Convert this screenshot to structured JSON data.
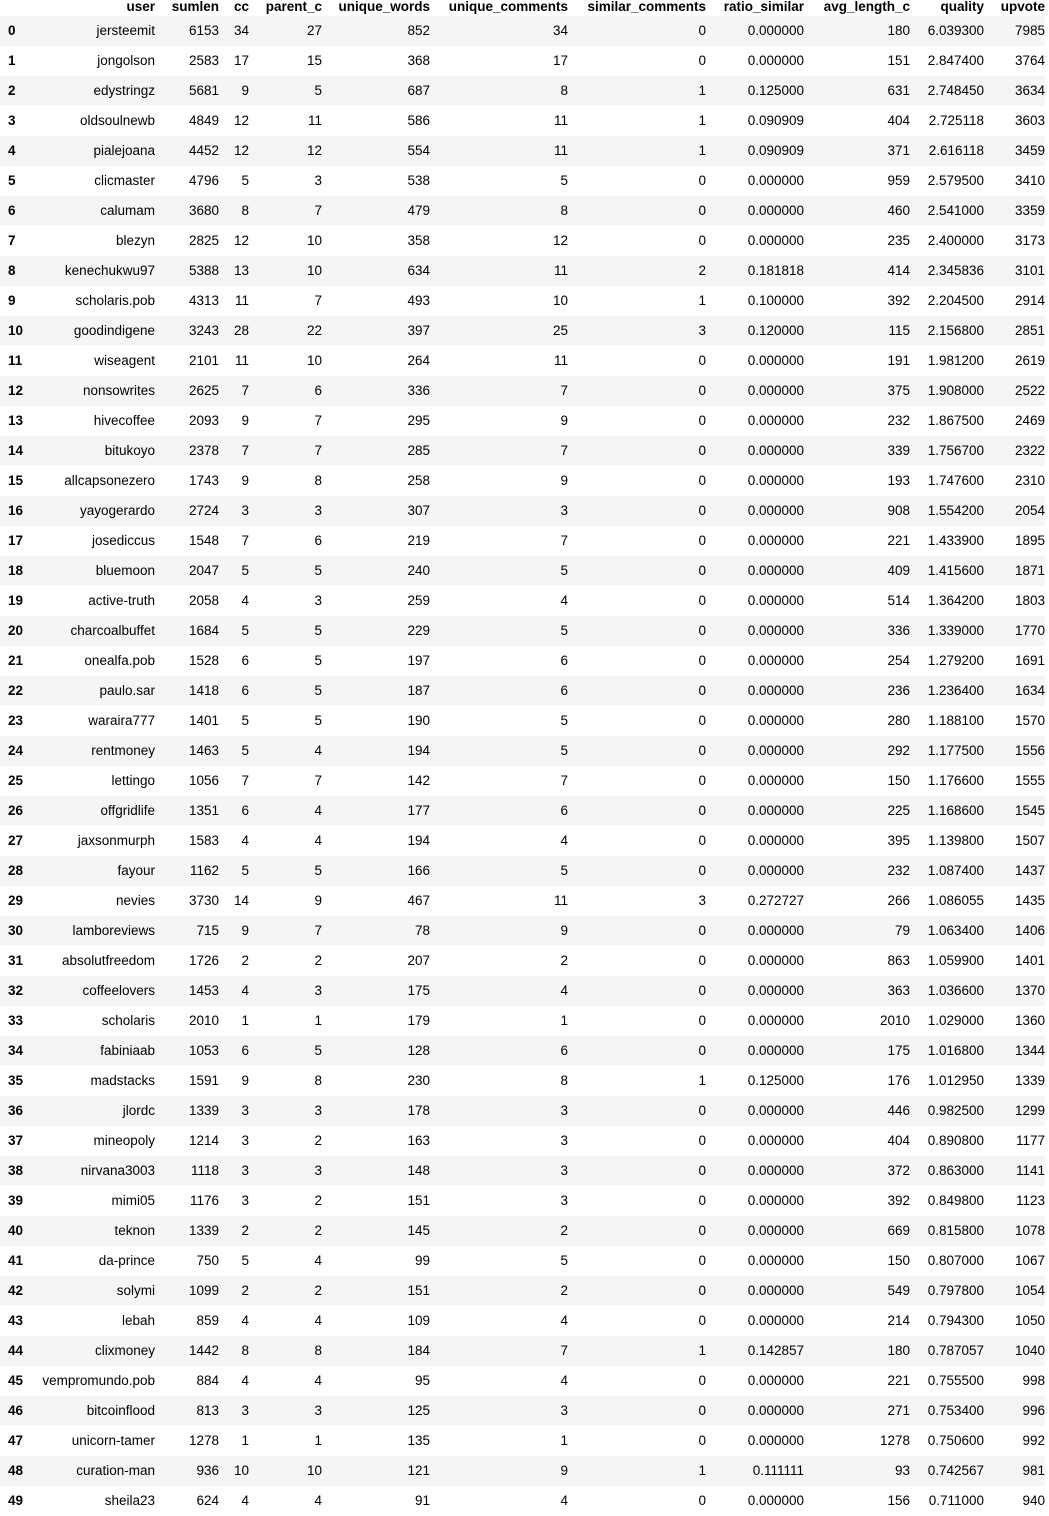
{
  "table": {
    "columns": [
      "user",
      "sumlen",
      "cc",
      "parent_c",
      "unique_words",
      "unique_comments",
      "similar_comments",
      "ratio_similar",
      "avg_length_c",
      "quality",
      "upvote"
    ],
    "rows": [
      [
        "0",
        "jersteemit",
        "6153",
        "34",
        "27",
        "852",
        "34",
        "0",
        "0.000000",
        "180",
        "6.039300",
        "7985"
      ],
      [
        "1",
        "jongolson",
        "2583",
        "17",
        "15",
        "368",
        "17",
        "0",
        "0.000000",
        "151",
        "2.847400",
        "3764"
      ],
      [
        "2",
        "edystringz",
        "5681",
        "9",
        "5",
        "687",
        "8",
        "1",
        "0.125000",
        "631",
        "2.748450",
        "3634"
      ],
      [
        "3",
        "oldsoulnewb",
        "4849",
        "12",
        "11",
        "586",
        "11",
        "1",
        "0.090909",
        "404",
        "2.725118",
        "3603"
      ],
      [
        "4",
        "pialejoana",
        "4452",
        "12",
        "12",
        "554",
        "11",
        "1",
        "0.090909",
        "371",
        "2.616118",
        "3459"
      ],
      [
        "5",
        "clicmaster",
        "4796",
        "5",
        "3",
        "538",
        "5",
        "0",
        "0.000000",
        "959",
        "2.579500",
        "3410"
      ],
      [
        "6",
        "calumam",
        "3680",
        "8",
        "7",
        "479",
        "8",
        "0",
        "0.000000",
        "460",
        "2.541000",
        "3359"
      ],
      [
        "7",
        "blezyn",
        "2825",
        "12",
        "10",
        "358",
        "12",
        "0",
        "0.000000",
        "235",
        "2.400000",
        "3173"
      ],
      [
        "8",
        "kenechukwu97",
        "5388",
        "13",
        "10",
        "634",
        "11",
        "2",
        "0.181818",
        "414",
        "2.345836",
        "3101"
      ],
      [
        "9",
        "scholaris.pob",
        "4313",
        "11",
        "7",
        "493",
        "10",
        "1",
        "0.100000",
        "392",
        "2.204500",
        "2914"
      ],
      [
        "10",
        "goodindigene",
        "3243",
        "28",
        "22",
        "397",
        "25",
        "3",
        "0.120000",
        "115",
        "2.156800",
        "2851"
      ],
      [
        "11",
        "wiseagent",
        "2101",
        "11",
        "10",
        "264",
        "11",
        "0",
        "0.000000",
        "191",
        "1.981200",
        "2619"
      ],
      [
        "12",
        "nonsowrites",
        "2625",
        "7",
        "6",
        "336",
        "7",
        "0",
        "0.000000",
        "375",
        "1.908000",
        "2522"
      ],
      [
        "13",
        "hivecoffee",
        "2093",
        "9",
        "7",
        "295",
        "9",
        "0",
        "0.000000",
        "232",
        "1.867500",
        "2469"
      ],
      [
        "14",
        "bitukoyo",
        "2378",
        "7",
        "7",
        "285",
        "7",
        "0",
        "0.000000",
        "339",
        "1.756700",
        "2322"
      ],
      [
        "15",
        "allcapsonezero",
        "1743",
        "9",
        "8",
        "258",
        "9",
        "0",
        "0.000000",
        "193",
        "1.747600",
        "2310"
      ],
      [
        "16",
        "yayogerardo",
        "2724",
        "3",
        "3",
        "307",
        "3",
        "0",
        "0.000000",
        "908",
        "1.554200",
        "2054"
      ],
      [
        "17",
        "josediccus",
        "1548",
        "7",
        "6",
        "219",
        "7",
        "0",
        "0.000000",
        "221",
        "1.433900",
        "1895"
      ],
      [
        "18",
        "bluemoon",
        "2047",
        "5",
        "5",
        "240",
        "5",
        "0",
        "0.000000",
        "409",
        "1.415600",
        "1871"
      ],
      [
        "19",
        "active-truth",
        "2058",
        "4",
        "3",
        "259",
        "4",
        "0",
        "0.000000",
        "514",
        "1.364200",
        "1803"
      ],
      [
        "20",
        "charcoalbuffet",
        "1684",
        "5",
        "5",
        "229",
        "5",
        "0",
        "0.000000",
        "336",
        "1.339000",
        "1770"
      ],
      [
        "21",
        "onealfa.pob",
        "1528",
        "6",
        "5",
        "197",
        "6",
        "0",
        "0.000000",
        "254",
        "1.279200",
        "1691"
      ],
      [
        "22",
        "paulo.sar",
        "1418",
        "6",
        "5",
        "187",
        "6",
        "0",
        "0.000000",
        "236",
        "1.236400",
        "1634"
      ],
      [
        "23",
        "waraira777",
        "1401",
        "5",
        "5",
        "190",
        "5",
        "0",
        "0.000000",
        "280",
        "1.188100",
        "1570"
      ],
      [
        "24",
        "rentmoney",
        "1463",
        "5",
        "4",
        "194",
        "5",
        "0",
        "0.000000",
        "292",
        "1.177500",
        "1556"
      ],
      [
        "25",
        "lettingo",
        "1056",
        "7",
        "7",
        "142",
        "7",
        "0",
        "0.000000",
        "150",
        "1.176600",
        "1555"
      ],
      [
        "26",
        "offgridlife",
        "1351",
        "6",
        "4",
        "177",
        "6",
        "0",
        "0.000000",
        "225",
        "1.168600",
        "1545"
      ],
      [
        "27",
        "jaxsonmurph",
        "1583",
        "4",
        "4",
        "194",
        "4",
        "0",
        "0.000000",
        "395",
        "1.139800",
        "1507"
      ],
      [
        "28",
        "fayour",
        "1162",
        "5",
        "5",
        "166",
        "5",
        "0",
        "0.000000",
        "232",
        "1.087400",
        "1437"
      ],
      [
        "29",
        "nevies",
        "3730",
        "14",
        "9",
        "467",
        "11",
        "3",
        "0.272727",
        "266",
        "1.086055",
        "1435"
      ],
      [
        "30",
        "lamboreviews",
        "715",
        "9",
        "7",
        "78",
        "9",
        "0",
        "0.000000",
        "79",
        "1.063400",
        "1406"
      ],
      [
        "31",
        "absolutfreedom",
        "1726",
        "2",
        "2",
        "207",
        "2",
        "0",
        "0.000000",
        "863",
        "1.059900",
        "1401"
      ],
      [
        "32",
        "coffeelovers",
        "1453",
        "4",
        "3",
        "175",
        "4",
        "0",
        "0.000000",
        "363",
        "1.036600",
        "1370"
      ],
      [
        "33",
        "scholaris",
        "2010",
        "1",
        "1",
        "179",
        "1",
        "0",
        "0.000000",
        "2010",
        "1.029000",
        "1360"
      ],
      [
        "34",
        "fabiniaab",
        "1053",
        "6",
        "5",
        "128",
        "6",
        "0",
        "0.000000",
        "175",
        "1.016800",
        "1344"
      ],
      [
        "35",
        "madstacks",
        "1591",
        "9",
        "8",
        "230",
        "8",
        "1",
        "0.125000",
        "176",
        "1.012950",
        "1339"
      ],
      [
        "36",
        "jlordc",
        "1339",
        "3",
        "3",
        "178",
        "3",
        "0",
        "0.000000",
        "446",
        "0.982500",
        "1299"
      ],
      [
        "37",
        "mineopoly",
        "1214",
        "3",
        "2",
        "163",
        "3",
        "0",
        "0.000000",
        "404",
        "0.890800",
        "1177"
      ],
      [
        "38",
        "nirvana3003",
        "1118",
        "3",
        "3",
        "148",
        "3",
        "0",
        "0.000000",
        "372",
        "0.863000",
        "1141"
      ],
      [
        "39",
        "mimi05",
        "1176",
        "3",
        "2",
        "151",
        "3",
        "0",
        "0.000000",
        "392",
        "0.849800",
        "1123"
      ],
      [
        "40",
        "teknon",
        "1339",
        "2",
        "2",
        "145",
        "2",
        "0",
        "0.000000",
        "669",
        "0.815800",
        "1078"
      ],
      [
        "41",
        "da-prince",
        "750",
        "5",
        "4",
        "99",
        "5",
        "0",
        "0.000000",
        "150",
        "0.807000",
        "1067"
      ],
      [
        "42",
        "solymi",
        "1099",
        "2",
        "2",
        "151",
        "2",
        "0",
        "0.000000",
        "549",
        "0.797800",
        "1054"
      ],
      [
        "43",
        "lebah",
        "859",
        "4",
        "4",
        "109",
        "4",
        "0",
        "0.000000",
        "214",
        "0.794300",
        "1050"
      ],
      [
        "44",
        "clixmoney",
        "1442",
        "8",
        "8",
        "184",
        "7",
        "1",
        "0.142857",
        "180",
        "0.787057",
        "1040"
      ],
      [
        "45",
        "vempromundo.pob",
        "884",
        "4",
        "4",
        "95",
        "4",
        "0",
        "0.000000",
        "221",
        "0.755500",
        "998"
      ],
      [
        "46",
        "bitcoinflood",
        "813",
        "3",
        "3",
        "125",
        "3",
        "0",
        "0.000000",
        "271",
        "0.753400",
        "996"
      ],
      [
        "47",
        "unicorn-tamer",
        "1278",
        "1",
        "1",
        "135",
        "1",
        "0",
        "0.000000",
        "1278",
        "0.750600",
        "992"
      ],
      [
        "48",
        "curation-man",
        "936",
        "10",
        "10",
        "121",
        "9",
        "1",
        "0.111111",
        "93",
        "0.742567",
        "981"
      ],
      [
        "49",
        "sheila23",
        "624",
        "4",
        "4",
        "91",
        "4",
        "0",
        "0.000000",
        "156",
        "0.711000",
        "940"
      ]
    ]
  }
}
